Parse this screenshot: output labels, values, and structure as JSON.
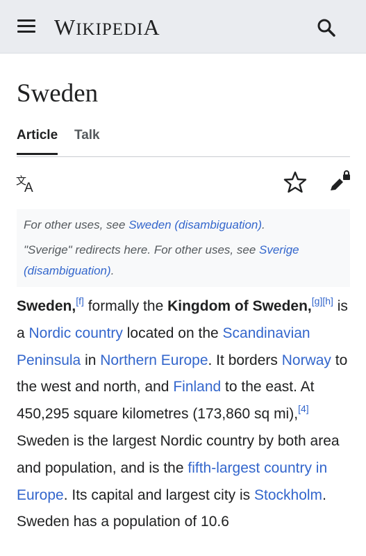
{
  "header": {
    "logo_first": "W",
    "logo_rest": "IKIPEDI",
    "logo_last": "A"
  },
  "page": {
    "title": "Sweden"
  },
  "tabs": [
    {
      "label": "Article",
      "active": true
    },
    {
      "label": "Talk",
      "active": false
    }
  ],
  "icons": {
    "menu": "hamburger-menu-icon",
    "search": "search-icon",
    "language": "language-icon",
    "watch": "star-icon",
    "edit": "edit-lock-icon"
  },
  "hatnote": {
    "line1_prefix": "For other uses, see ",
    "line1_link": "Sweden (disambiguation)",
    "line1_suffix": ".",
    "line2_prefix": "\"Sverige\" redirects here. For other uses, see ",
    "line2_link": "Sverige (disambiguation)",
    "line2_suffix": "."
  },
  "paragraph": {
    "bold1": "Sweden,",
    "ref_f": "[f]",
    "t1": " formally the ",
    "bold2": "Kingdom of Sweden,",
    "ref_g": "[g]",
    "ref_h": "[h]",
    "t2": " is a ",
    "link_nordic": "Nordic country",
    "t3": " located on the ",
    "link_scand": "Scandinavian Peninsula",
    "t4": " in ",
    "link_neurope": "Northern Europe",
    "t5": ". It borders ",
    "link_norway": "Norway",
    "t6": " to the west and north, and ",
    "link_finland": "Finland",
    "t7": " to the east. At 450,295 square kilometres (173,860 sq mi),",
    "ref_4": "[4]",
    "t8": " Sweden is the largest Nordic country by both area and population, and is the ",
    "link_fifth": "fifth-largest country in Europe",
    "t9": ". Its capital and largest city is ",
    "link_stockholm": "Stockholm",
    "t10": ". Sweden has a population of 10.6"
  },
  "colors": {
    "link": "#3366cc",
    "header_bg": "#eaecf0",
    "text": "#202122",
    "hatnote_bg": "#f8f9fa"
  }
}
